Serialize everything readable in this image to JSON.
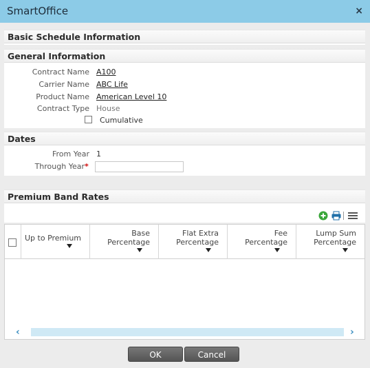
{
  "window": {
    "title": "SmartOffice",
    "close_glyph": "×"
  },
  "sections": {
    "basic": "Basic Schedule Information",
    "general": "General Information",
    "dates": "Dates",
    "premium": "Premium Band Rates"
  },
  "general": {
    "contract_name_label": "Contract Name",
    "contract_name_value": "A100",
    "carrier_name_label": "Carrier Name",
    "carrier_name_value": "ABC Life",
    "product_name_label": "Product Name",
    "product_name_value": "American Level 10",
    "contract_type_label": "Contract Type",
    "contract_type_value": "House",
    "cumulative_label": "Cumulative"
  },
  "dates": {
    "from_year_label": "From Year",
    "from_year_value": "1",
    "through_year_label": "Through Year",
    "required_marker": "*",
    "through_year_value": ""
  },
  "toolbar": {
    "icons": [
      "add-icon",
      "print-icon",
      "list-menu-icon"
    ]
  },
  "grid": {
    "columns": [
      {
        "line1": "Up to Premium",
        "line2": ""
      },
      {
        "line1": "Base",
        "line2": "Percentage"
      },
      {
        "line1": "Flat Extra",
        "line2": "Percentage"
      },
      {
        "line1": "Fee",
        "line2": "Percentage"
      },
      {
        "line1": "Lump Sum",
        "line2": "Percentage"
      }
    ],
    "rows": []
  },
  "buttons": {
    "ok": "OK",
    "cancel": "Cancel"
  }
}
